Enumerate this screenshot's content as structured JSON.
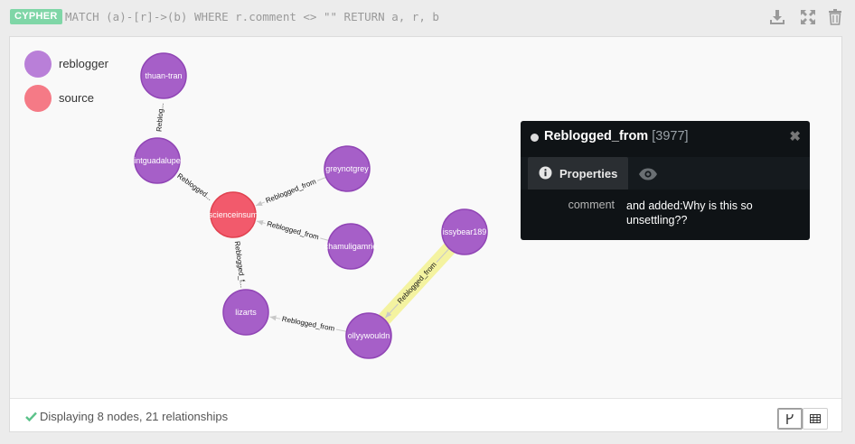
{
  "query": {
    "badge": "CYPHER",
    "text": "MATCH (a)-[r]->(b) WHERE r.comment <> \"\" RETURN a, r, b"
  },
  "toolbar": {
    "icons": [
      "download-icon",
      "expand-icon",
      "trash-icon"
    ]
  },
  "legend": [
    {
      "label": "reblogger",
      "color": "#a65fc8"
    },
    {
      "label": "source",
      "color": "#f25a6c"
    }
  ],
  "graph": {
    "nodes": [
      {
        "id": "n1",
        "label": "thuan-tran",
        "type": "reblogger"
      },
      {
        "id": "n2",
        "label": "intguadalupe",
        "type": "reblogger"
      },
      {
        "id": "n3",
        "label": "greynotgrey",
        "type": "reblogger"
      },
      {
        "id": "n4",
        "label": "scienceinsum",
        "type": "source"
      },
      {
        "id": "n5",
        "label": "chamuligamrie",
        "type": "reblogger"
      },
      {
        "id": "n6",
        "label": "issybear189",
        "type": "reblogger"
      },
      {
        "id": "n7",
        "label": "lizarts",
        "type": "reblogger"
      },
      {
        "id": "n8",
        "label": "ollyywouldn",
        "type": "reblogger"
      }
    ],
    "relationships": [
      {
        "from": "n1",
        "to": "n2",
        "label": "Reblog..."
      },
      {
        "from": "n2",
        "to": "n4",
        "label": "Reblogged..."
      },
      {
        "from": "n3",
        "to": "n4",
        "label": "Reblogged_from"
      },
      {
        "from": "n5",
        "to": "n4",
        "label": "Reblogged_from"
      },
      {
        "from": "n7",
        "to": "n4",
        "label": "Reblogged_f..."
      },
      {
        "from": "n8",
        "to": "n7",
        "label": "Reblogged_from"
      },
      {
        "from": "n6",
        "to": "n8",
        "label": "Reblogged_from",
        "selected": true
      }
    ]
  },
  "panel": {
    "title": "Reblogged_from",
    "id": "[3977]",
    "tab_properties": "Properties",
    "properties": [
      {
        "key": "comment",
        "value": "and added:Why is this so unsettling??"
      }
    ]
  },
  "status": {
    "text": "Displaying 8 nodes, 21 relationships"
  },
  "colors": {
    "reblogger": "#a65fc8",
    "source": "#f25a6c",
    "accent": "#7fd6a7",
    "highlight": "#f4f3a0"
  }
}
